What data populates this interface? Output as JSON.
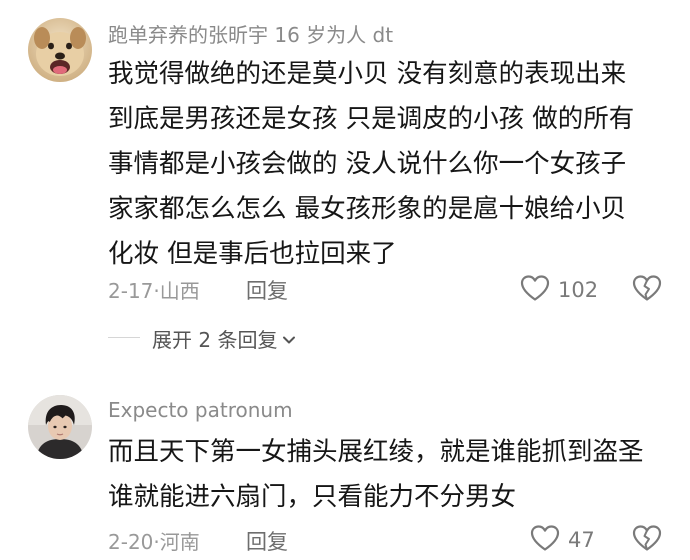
{
  "comments": [
    {
      "username": "跑单弃养的张昕宇 16 岁为人 dt",
      "lines": [
        "我觉得做绝的还是莫小贝  没有刻意的表现出来",
        "到底是男孩还是女孩  只是调皮的小孩  做的所有",
        "事情都是小孩会做的  没人说什么你一个女孩子",
        "家家都怎么怎么  最女孩形象的是扈十娘给小贝",
        "化妆  但是事后也拉回来了"
      ],
      "date": "2-17",
      "separator": "·",
      "location": "山西",
      "reply_label": "回复",
      "like_count": "102",
      "expand_label": "展开 2 条回复"
    },
    {
      "username": "Expecto  patronum",
      "lines": [
        "而且天下第一女捕头展红绫，就是谁能抓到盗圣",
        "谁就能进六扇门，只看能力不分男女"
      ],
      "date": "2-20",
      "separator": "·",
      "location": "河南",
      "reply_label": "回复",
      "like_count": "47"
    }
  ],
  "colors": {
    "text": "#161616",
    "username": "#8a8a8a",
    "meta": "#999999",
    "icon": "#7a7a7a",
    "background": "#ffffff"
  },
  "icons": {
    "like": "heart-outline-icon",
    "dislike": "broken-heart-icon",
    "expand": "chevron-down-icon"
  }
}
